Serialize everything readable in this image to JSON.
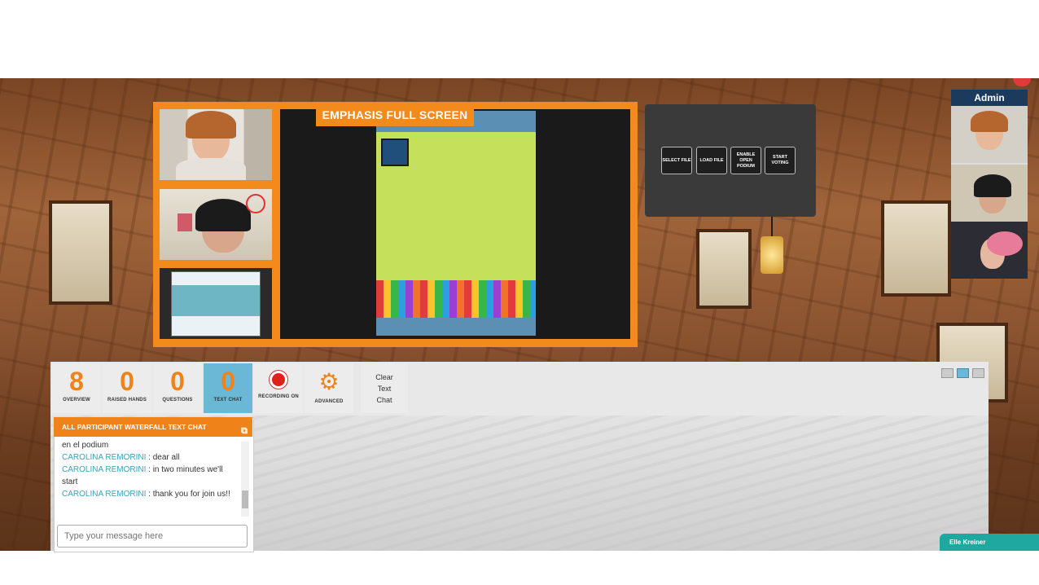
{
  "emphasis": {
    "label": "EMPHASIS FULL SCREEN"
  },
  "controls": [
    {
      "label": "SELECT FILE"
    },
    {
      "label": "LOAD FILE"
    },
    {
      "label": "ENABLE OPEN PODIUM"
    },
    {
      "label": "START VOTING"
    }
  ],
  "admin": {
    "title": "Admin"
  },
  "toolbar": {
    "overview": {
      "count": "8",
      "label": "OVERVIEW"
    },
    "raised_hands": {
      "count": "0",
      "label": "RAISED HANDS"
    },
    "questions": {
      "count": "0",
      "label": "QUESTIONS"
    },
    "text_chat": {
      "count": "0",
      "label": "TEXT CHAT"
    },
    "recording": {
      "label": "RECORDING ON"
    },
    "advanced": {
      "label": "ADVANCED"
    },
    "clear": {
      "line1": "Clear",
      "line2": "Text",
      "line3": "Chat"
    }
  },
  "chat": {
    "header": "ALL PARTICIPANT WATERFALL TEXT CHAT",
    "pre_line": "en el podium",
    "messages": [
      {
        "who": "CAROLINA REMORINI",
        "text": " : dear all"
      },
      {
        "who": "CAROLINA REMORINI",
        "text": " : in two minutes we'll start"
      },
      {
        "who": "CAROLINA REMORINI",
        "text": " : thank you for join us!!"
      }
    ],
    "input_placeholder": "Type your message here"
  },
  "user_tag": "Elle Kreiner",
  "colors": {
    "accent": "#f28a1c",
    "active_tab": "#6ab8d6",
    "chat_name": "#3aa4b8",
    "admin_header": "#1c3a5c",
    "user_tag": "#1fa8a0"
  }
}
